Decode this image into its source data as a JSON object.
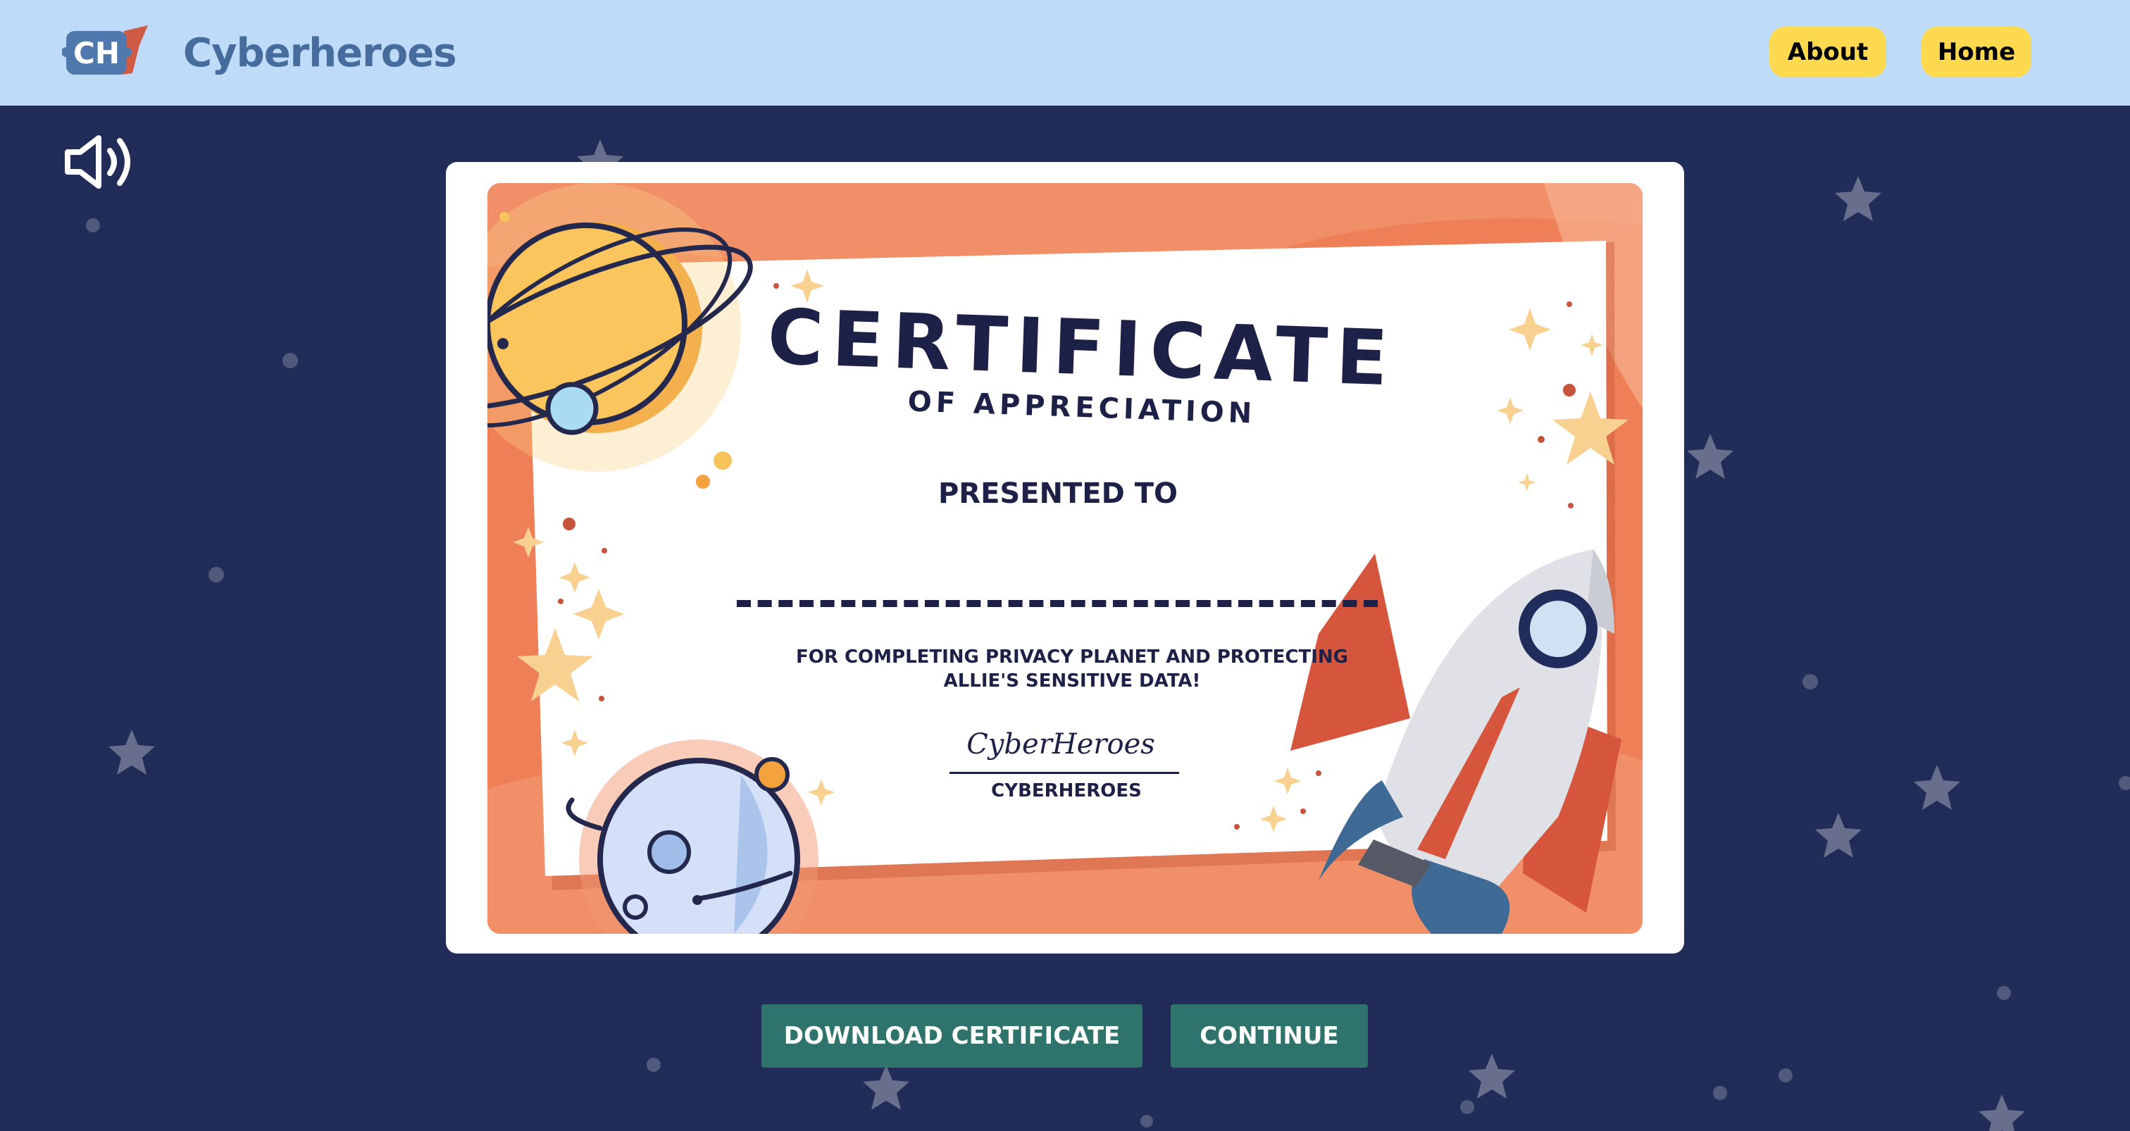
{
  "header": {
    "logo_text": "CH",
    "brand": "Cyberheroes",
    "nav": [
      {
        "label": "About"
      },
      {
        "label": "Home"
      }
    ]
  },
  "sound": {
    "icon": "speaker-volume-icon"
  },
  "certificate": {
    "title": "CERTIFICATE",
    "subtitle": "OF APPRECIATION",
    "presented_to": "PRESENTED TO",
    "reason_line1": "FOR COMPLETING PRIVACY PLANET AND PROTECTING",
    "reason_line2": "ALLIE'S SENSITIVE DATA!",
    "signature": "CyberHeroes",
    "signer": "CYBERHEROES"
  },
  "actions": {
    "download_label": "DOWNLOAD CERTIFICATE",
    "continue_label": "CONTINUE"
  },
  "colors": {
    "background": "#212c58",
    "header": "#bedcfa",
    "nav_button": "#fcd94e",
    "action_button": "#2e736c",
    "certificate_orange": "#ef7f57",
    "text_dark": "#1d2147"
  }
}
